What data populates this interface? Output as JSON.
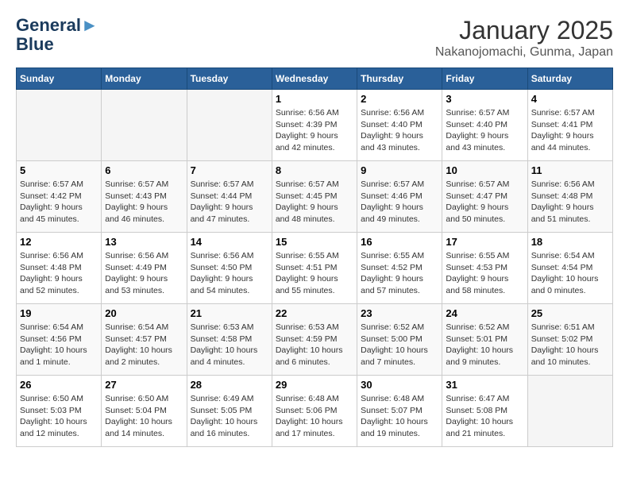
{
  "header": {
    "logo_line1": "General",
    "logo_line2": "Blue",
    "month_title": "January 2025",
    "location": "Nakanojomachi, Gunma, Japan"
  },
  "weekdays": [
    "Sunday",
    "Monday",
    "Tuesday",
    "Wednesday",
    "Thursday",
    "Friday",
    "Saturday"
  ],
  "weeks": [
    [
      {
        "day": "",
        "empty": true
      },
      {
        "day": "",
        "empty": true
      },
      {
        "day": "",
        "empty": true
      },
      {
        "day": "1",
        "sunrise": "6:56 AM",
        "sunset": "4:39 PM",
        "daylight": "9 hours and 42 minutes."
      },
      {
        "day": "2",
        "sunrise": "6:56 AM",
        "sunset": "4:40 PM",
        "daylight": "9 hours and 43 minutes."
      },
      {
        "day": "3",
        "sunrise": "6:57 AM",
        "sunset": "4:40 PM",
        "daylight": "9 hours and 43 minutes."
      },
      {
        "day": "4",
        "sunrise": "6:57 AM",
        "sunset": "4:41 PM",
        "daylight": "9 hours and 44 minutes."
      }
    ],
    [
      {
        "day": "5",
        "sunrise": "6:57 AM",
        "sunset": "4:42 PM",
        "daylight": "9 hours and 45 minutes."
      },
      {
        "day": "6",
        "sunrise": "6:57 AM",
        "sunset": "4:43 PM",
        "daylight": "9 hours and 46 minutes."
      },
      {
        "day": "7",
        "sunrise": "6:57 AM",
        "sunset": "4:44 PM",
        "daylight": "9 hours and 47 minutes."
      },
      {
        "day": "8",
        "sunrise": "6:57 AM",
        "sunset": "4:45 PM",
        "daylight": "9 hours and 48 minutes."
      },
      {
        "day": "9",
        "sunrise": "6:57 AM",
        "sunset": "4:46 PM",
        "daylight": "9 hours and 49 minutes."
      },
      {
        "day": "10",
        "sunrise": "6:57 AM",
        "sunset": "4:47 PM",
        "daylight": "9 hours and 50 minutes."
      },
      {
        "day": "11",
        "sunrise": "6:56 AM",
        "sunset": "4:48 PM",
        "daylight": "9 hours and 51 minutes."
      }
    ],
    [
      {
        "day": "12",
        "sunrise": "6:56 AM",
        "sunset": "4:48 PM",
        "daylight": "9 hours and 52 minutes."
      },
      {
        "day": "13",
        "sunrise": "6:56 AM",
        "sunset": "4:49 PM",
        "daylight": "9 hours and 53 minutes."
      },
      {
        "day": "14",
        "sunrise": "6:56 AM",
        "sunset": "4:50 PM",
        "daylight": "9 hours and 54 minutes."
      },
      {
        "day": "15",
        "sunrise": "6:55 AM",
        "sunset": "4:51 PM",
        "daylight": "9 hours and 55 minutes."
      },
      {
        "day": "16",
        "sunrise": "6:55 AM",
        "sunset": "4:52 PM",
        "daylight": "9 hours and 57 minutes."
      },
      {
        "day": "17",
        "sunrise": "6:55 AM",
        "sunset": "4:53 PM",
        "daylight": "9 hours and 58 minutes."
      },
      {
        "day": "18",
        "sunrise": "6:54 AM",
        "sunset": "4:54 PM",
        "daylight": "10 hours and 0 minutes."
      }
    ],
    [
      {
        "day": "19",
        "sunrise": "6:54 AM",
        "sunset": "4:56 PM",
        "daylight": "10 hours and 1 minute."
      },
      {
        "day": "20",
        "sunrise": "6:54 AM",
        "sunset": "4:57 PM",
        "daylight": "10 hours and 2 minutes."
      },
      {
        "day": "21",
        "sunrise": "6:53 AM",
        "sunset": "4:58 PM",
        "daylight": "10 hours and 4 minutes."
      },
      {
        "day": "22",
        "sunrise": "6:53 AM",
        "sunset": "4:59 PM",
        "daylight": "10 hours and 6 minutes."
      },
      {
        "day": "23",
        "sunrise": "6:52 AM",
        "sunset": "5:00 PM",
        "daylight": "10 hours and 7 minutes."
      },
      {
        "day": "24",
        "sunrise": "6:52 AM",
        "sunset": "5:01 PM",
        "daylight": "10 hours and 9 minutes."
      },
      {
        "day": "25",
        "sunrise": "6:51 AM",
        "sunset": "5:02 PM",
        "daylight": "10 hours and 10 minutes."
      }
    ],
    [
      {
        "day": "26",
        "sunrise": "6:50 AM",
        "sunset": "5:03 PM",
        "daylight": "10 hours and 12 minutes."
      },
      {
        "day": "27",
        "sunrise": "6:50 AM",
        "sunset": "5:04 PM",
        "daylight": "10 hours and 14 minutes."
      },
      {
        "day": "28",
        "sunrise": "6:49 AM",
        "sunset": "5:05 PM",
        "daylight": "10 hours and 16 minutes."
      },
      {
        "day": "29",
        "sunrise": "6:48 AM",
        "sunset": "5:06 PM",
        "daylight": "10 hours and 17 minutes."
      },
      {
        "day": "30",
        "sunrise": "6:48 AM",
        "sunset": "5:07 PM",
        "daylight": "10 hours and 19 minutes."
      },
      {
        "day": "31",
        "sunrise": "6:47 AM",
        "sunset": "5:08 PM",
        "daylight": "10 hours and 21 minutes."
      },
      {
        "day": "",
        "empty": true
      }
    ]
  ]
}
